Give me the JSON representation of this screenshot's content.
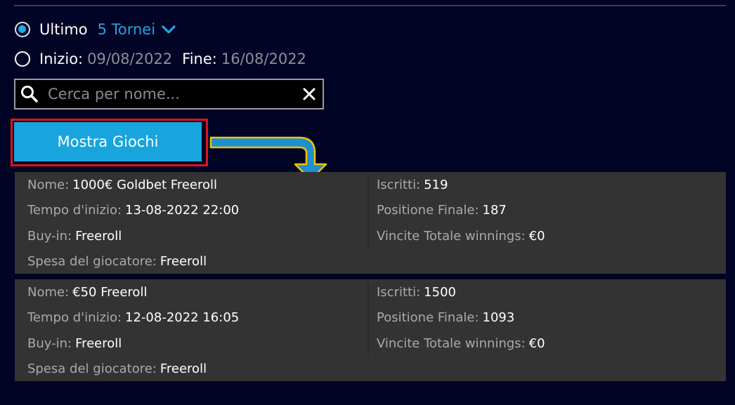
{
  "filter": {
    "last_option_label": "Ultimo",
    "last_value": "5 Tornei",
    "range_start_label": "Inizio:",
    "range_start_value": "09/08/2022",
    "range_end_label": "Fine:",
    "range_end_value": "16/08/2022"
  },
  "search": {
    "placeholder": "Cerca per nome..."
  },
  "show_button_label": "Mostra Giochi",
  "tournaments": [
    {
      "name_label": "Nome:",
      "name": "1000€ Goldbet Freeroll",
      "start_label": "Tempo d'inizio:",
      "start": "13-08-2022 22:00",
      "buyin_label": "Buy-in:",
      "buyin": "Freeroll",
      "spend_label": "Spesa del giocatore:",
      "spend": "Freeroll",
      "entrants_label": "Iscritti:",
      "entrants": "519",
      "position_label": "Positione Finale:",
      "position": "187",
      "winnings_label": "Vincite Totale winnings:",
      "winnings": "€0"
    },
    {
      "name_label": "Nome:",
      "name": "€50 Freeroll",
      "start_label": "Tempo d'inizio:",
      "start": "12-08-2022 16:05",
      "buyin_label": "Buy-in:",
      "buyin": "Freeroll",
      "spend_label": "Spesa del giocatore:",
      "spend": "Freeroll",
      "entrants_label": "Iscritti:",
      "entrants": "1500",
      "position_label": "Positione Finale:",
      "position": "1093",
      "winnings_label": "Vincite Totale winnings:",
      "winnings": "€0"
    }
  ],
  "icons": {
    "search": "magnifier-icon",
    "clear": "close-icon",
    "dropdown": "chevron-down-icon",
    "annotation": "curved-arrow-icon"
  },
  "colors": {
    "background": "#010425",
    "accent": "#22a5e0",
    "button": "#18a4dc",
    "card": "#333333",
    "highlight": "#e0141c",
    "annotation_arrow": "#1e8fd0",
    "annotation_outline": "#f2c300"
  }
}
